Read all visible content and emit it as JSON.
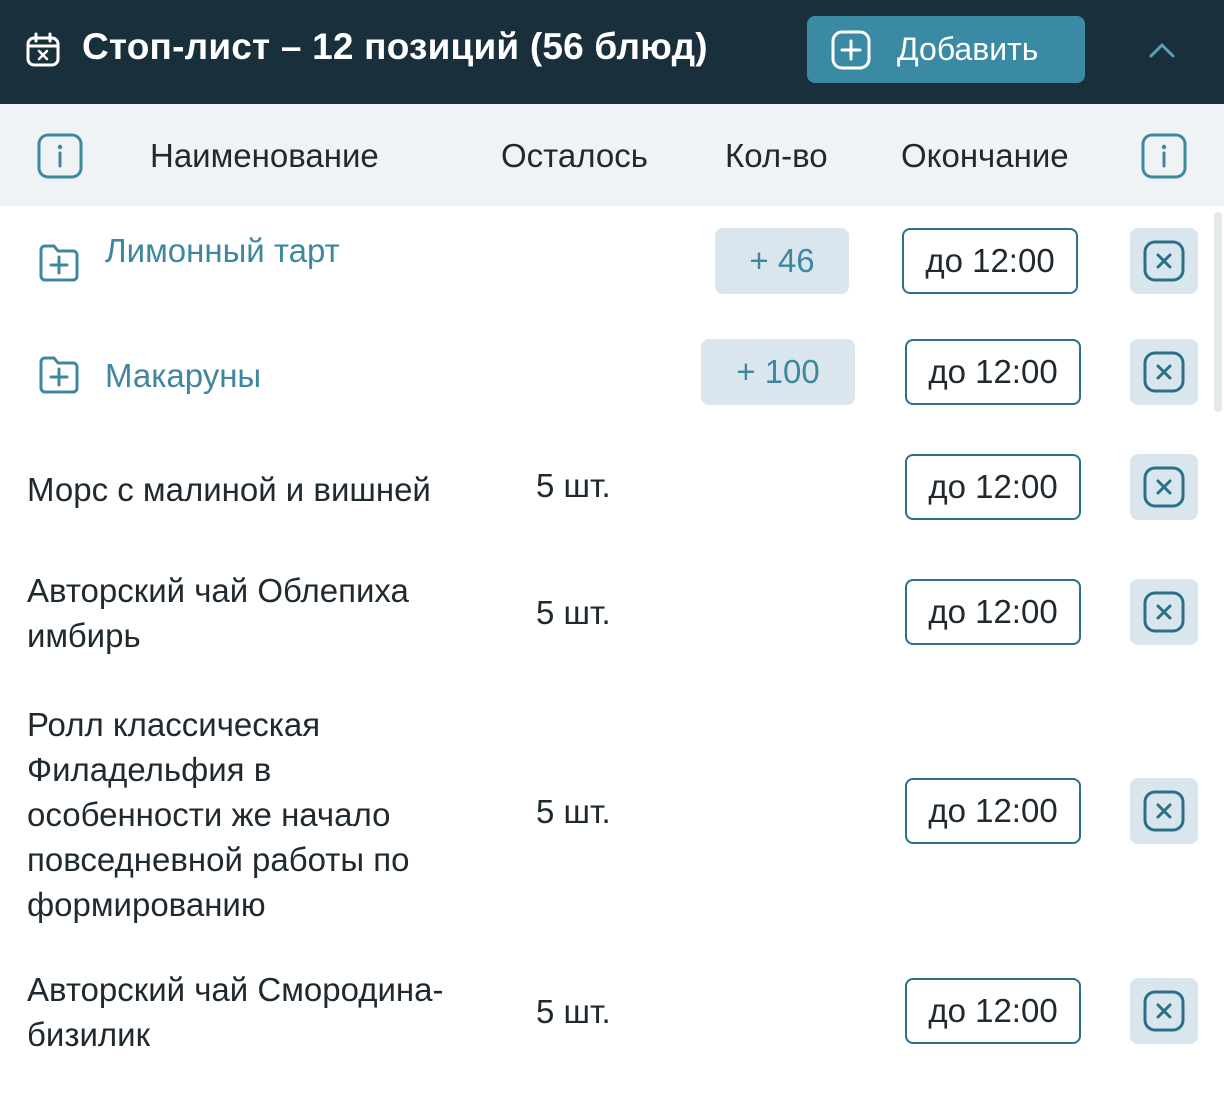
{
  "header": {
    "title": "Стоп-лист – 12 позиций (56 блюд)",
    "add_label": "Добавить",
    "icons": {
      "calendar": "calendar-x-icon",
      "add": "plus-square-icon",
      "collapse": "chevron-up-icon"
    }
  },
  "columns": {
    "name": "Наименование",
    "remaining": "Осталось",
    "qty": "Кол-во",
    "end": "Окончание"
  },
  "rows": [
    {
      "name": "Лимонный тарт",
      "is_group": true,
      "remaining": "",
      "qty": "+ 46",
      "end": "до 12:00"
    },
    {
      "name": "Макаруны",
      "is_group": true,
      "remaining": "",
      "qty": "+ 100",
      "end": "до 12:00"
    },
    {
      "name": "Морс с малиной и вишней",
      "is_group": false,
      "remaining": "5 шт.",
      "qty": "",
      "end": "до 12:00"
    },
    {
      "name": "Авторский чай Облепиха имбирь",
      "is_group": false,
      "remaining": "5 шт.",
      "qty": "",
      "end": "до 12:00"
    },
    {
      "name": "Ролл классическая Филадельфия в особенности же начало повседневной работы по формированию",
      "is_group": false,
      "remaining": "5 шт.",
      "qty": "",
      "end": "до 12:00"
    },
    {
      "name": "Авторский чай Смородина-бизилик",
      "is_group": false,
      "remaining": "5 шт.",
      "qty": "",
      "end": "до 12:00"
    }
  ],
  "colors": {
    "header_bg": "#19303c",
    "accent": "#3b8aa3",
    "link": "#3f87a0",
    "chip_bg": "#d9e6ed",
    "colhead_bg": "#f0f3f5"
  }
}
